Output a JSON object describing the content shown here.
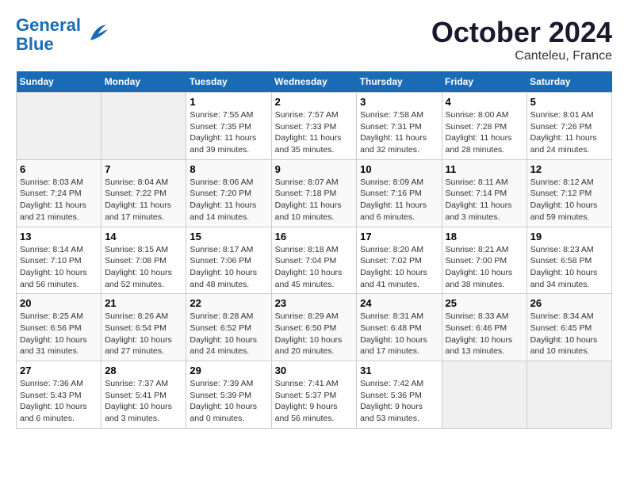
{
  "header": {
    "logo_line1": "General",
    "logo_line2": "Blue",
    "month": "October 2024",
    "location": "Canteleu, France"
  },
  "columns": [
    "Sunday",
    "Monday",
    "Tuesday",
    "Wednesday",
    "Thursday",
    "Friday",
    "Saturday"
  ],
  "weeks": [
    {
      "days": [
        {
          "num": "",
          "info": ""
        },
        {
          "num": "",
          "info": ""
        },
        {
          "num": "1",
          "info": "Sunrise: 7:55 AM\nSunset: 7:35 PM\nDaylight: 11 hours and 39 minutes."
        },
        {
          "num": "2",
          "info": "Sunrise: 7:57 AM\nSunset: 7:33 PM\nDaylight: 11 hours and 35 minutes."
        },
        {
          "num": "3",
          "info": "Sunrise: 7:58 AM\nSunset: 7:31 PM\nDaylight: 11 hours and 32 minutes."
        },
        {
          "num": "4",
          "info": "Sunrise: 8:00 AM\nSunset: 7:28 PM\nDaylight: 11 hours and 28 minutes."
        },
        {
          "num": "5",
          "info": "Sunrise: 8:01 AM\nSunset: 7:26 PM\nDaylight: 11 hours and 24 minutes."
        }
      ]
    },
    {
      "days": [
        {
          "num": "6",
          "info": "Sunrise: 8:03 AM\nSunset: 7:24 PM\nDaylight: 11 hours and 21 minutes."
        },
        {
          "num": "7",
          "info": "Sunrise: 8:04 AM\nSunset: 7:22 PM\nDaylight: 11 hours and 17 minutes."
        },
        {
          "num": "8",
          "info": "Sunrise: 8:06 AM\nSunset: 7:20 PM\nDaylight: 11 hours and 14 minutes."
        },
        {
          "num": "9",
          "info": "Sunrise: 8:07 AM\nSunset: 7:18 PM\nDaylight: 11 hours and 10 minutes."
        },
        {
          "num": "10",
          "info": "Sunrise: 8:09 AM\nSunset: 7:16 PM\nDaylight: 11 hours and 6 minutes."
        },
        {
          "num": "11",
          "info": "Sunrise: 8:11 AM\nSunset: 7:14 PM\nDaylight: 11 hours and 3 minutes."
        },
        {
          "num": "12",
          "info": "Sunrise: 8:12 AM\nSunset: 7:12 PM\nDaylight: 10 hours and 59 minutes."
        }
      ]
    },
    {
      "days": [
        {
          "num": "13",
          "info": "Sunrise: 8:14 AM\nSunset: 7:10 PM\nDaylight: 10 hours and 56 minutes."
        },
        {
          "num": "14",
          "info": "Sunrise: 8:15 AM\nSunset: 7:08 PM\nDaylight: 10 hours and 52 minutes."
        },
        {
          "num": "15",
          "info": "Sunrise: 8:17 AM\nSunset: 7:06 PM\nDaylight: 10 hours and 48 minutes."
        },
        {
          "num": "16",
          "info": "Sunrise: 8:18 AM\nSunset: 7:04 PM\nDaylight: 10 hours and 45 minutes."
        },
        {
          "num": "17",
          "info": "Sunrise: 8:20 AM\nSunset: 7:02 PM\nDaylight: 10 hours and 41 minutes."
        },
        {
          "num": "18",
          "info": "Sunrise: 8:21 AM\nSunset: 7:00 PM\nDaylight: 10 hours and 38 minutes."
        },
        {
          "num": "19",
          "info": "Sunrise: 8:23 AM\nSunset: 6:58 PM\nDaylight: 10 hours and 34 minutes."
        }
      ]
    },
    {
      "days": [
        {
          "num": "20",
          "info": "Sunrise: 8:25 AM\nSunset: 6:56 PM\nDaylight: 10 hours and 31 minutes."
        },
        {
          "num": "21",
          "info": "Sunrise: 8:26 AM\nSunset: 6:54 PM\nDaylight: 10 hours and 27 minutes."
        },
        {
          "num": "22",
          "info": "Sunrise: 8:28 AM\nSunset: 6:52 PM\nDaylight: 10 hours and 24 minutes."
        },
        {
          "num": "23",
          "info": "Sunrise: 8:29 AM\nSunset: 6:50 PM\nDaylight: 10 hours and 20 minutes."
        },
        {
          "num": "24",
          "info": "Sunrise: 8:31 AM\nSunset: 6:48 PM\nDaylight: 10 hours and 17 minutes."
        },
        {
          "num": "25",
          "info": "Sunrise: 8:33 AM\nSunset: 6:46 PM\nDaylight: 10 hours and 13 minutes."
        },
        {
          "num": "26",
          "info": "Sunrise: 8:34 AM\nSunset: 6:45 PM\nDaylight: 10 hours and 10 minutes."
        }
      ]
    },
    {
      "days": [
        {
          "num": "27",
          "info": "Sunrise: 7:36 AM\nSunset: 5:43 PM\nDaylight: 10 hours and 6 minutes."
        },
        {
          "num": "28",
          "info": "Sunrise: 7:37 AM\nSunset: 5:41 PM\nDaylight: 10 hours and 3 minutes."
        },
        {
          "num": "29",
          "info": "Sunrise: 7:39 AM\nSunset: 5:39 PM\nDaylight: 10 hours and 0 minutes."
        },
        {
          "num": "30",
          "info": "Sunrise: 7:41 AM\nSunset: 5:37 PM\nDaylight: 9 hours and 56 minutes."
        },
        {
          "num": "31",
          "info": "Sunrise: 7:42 AM\nSunset: 5:36 PM\nDaylight: 9 hours and 53 minutes."
        },
        {
          "num": "",
          "info": ""
        },
        {
          "num": "",
          "info": ""
        }
      ]
    }
  ]
}
